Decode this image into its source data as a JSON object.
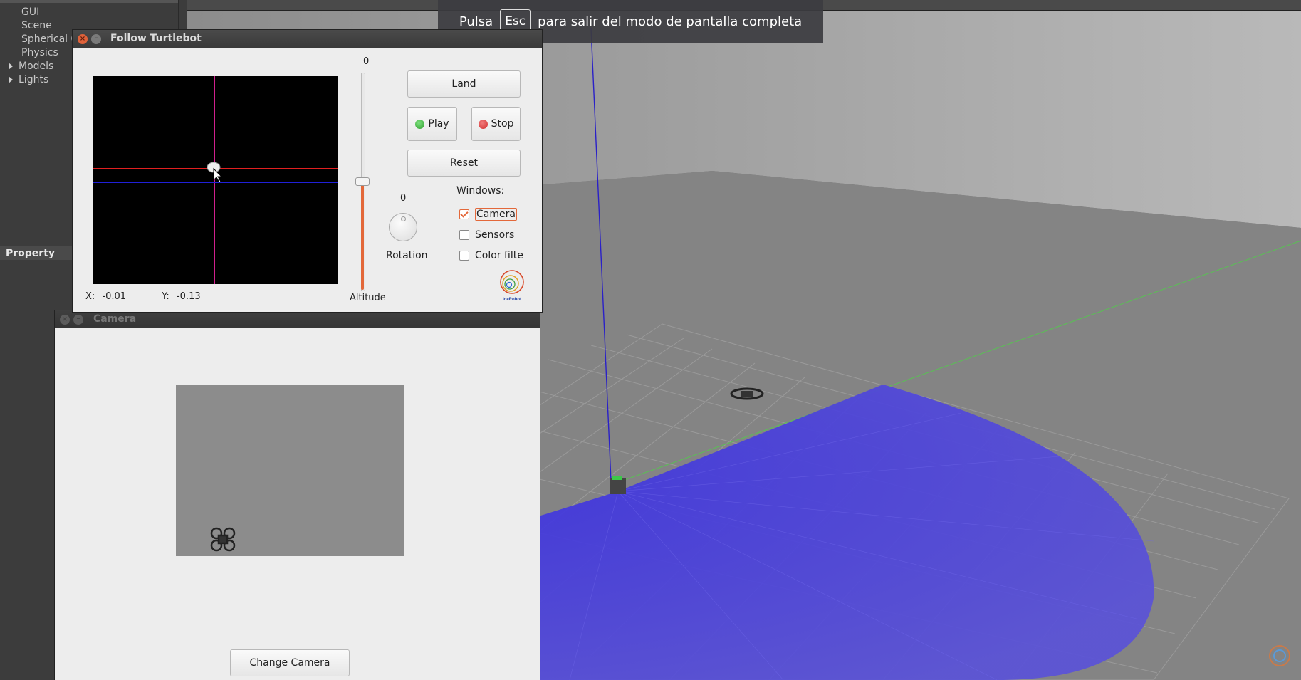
{
  "fullscreen_banner": {
    "prefix": "Pulsa",
    "key": "Esc",
    "suffix": "para salir del modo de pantalla completa"
  },
  "gazebo": {
    "tree": [
      {
        "label": "GUI",
        "expandable": false
      },
      {
        "label": "Scene",
        "expandable": false
      },
      {
        "label": "Spherical C",
        "expandable": false
      },
      {
        "label": "Physics",
        "expandable": false
      },
      {
        "label": "Models",
        "expandable": true
      },
      {
        "label": "Lights",
        "expandable": true
      }
    ],
    "property_header": "Property"
  },
  "follow_window": {
    "title": "Follow Turtlebot",
    "x_label": "X:",
    "x_value": "-0.01",
    "y_label": "Y:",
    "y_value": "-0.13",
    "altitude_value": "0",
    "altitude_label": "Altitude",
    "rotation_value": "0",
    "rotation_label": "Rotation",
    "land_label": "Land",
    "play_label": "Play",
    "stop_label": "Stop",
    "reset_label": "Reset",
    "windows_label": "Windows:",
    "camera_label": "Camera",
    "camera_checked": true,
    "sensors_label": "Sensors",
    "sensors_checked": false,
    "color_label": "Color filte",
    "color_checked": false,
    "logo_text": "IdeRobot"
  },
  "camera_window": {
    "title": "Camera",
    "change_camera_label": "Change Camera"
  },
  "colors": {
    "accent": "#e3683a",
    "play_led": "#2e9e2e",
    "stop_led": "#d23030",
    "laser_blue": "#2a20c8"
  }
}
